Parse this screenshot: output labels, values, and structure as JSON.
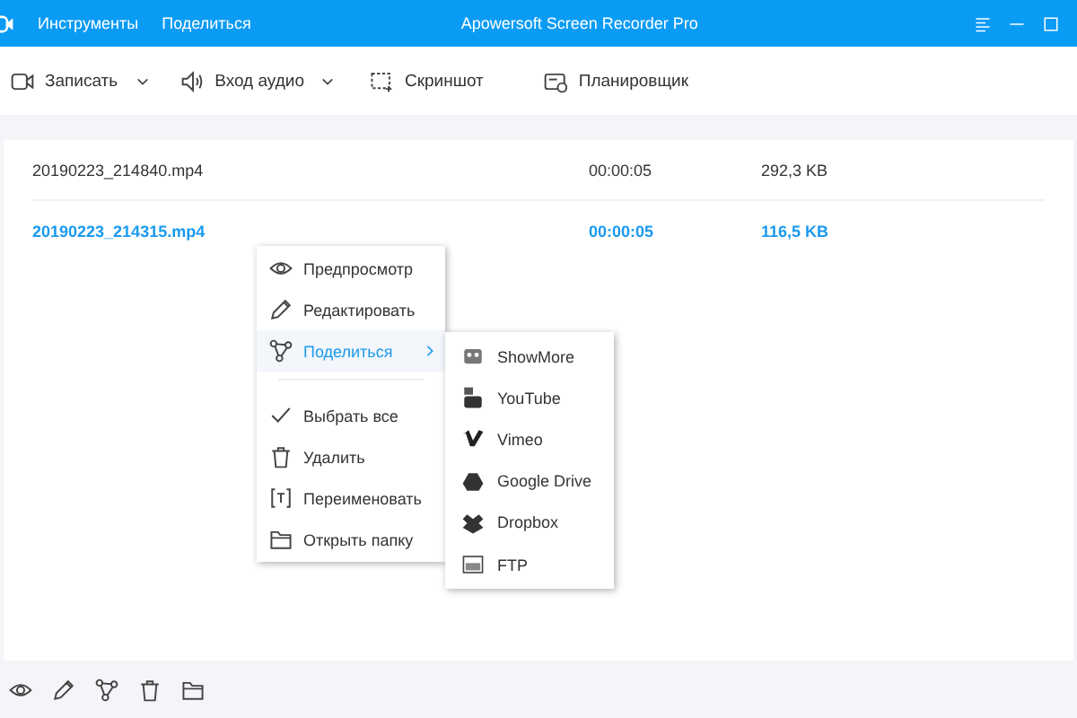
{
  "window": {
    "title": "Apowersoft Screen Recorder Pro",
    "menu": [
      "Инструменты",
      "Поделиться"
    ]
  },
  "toolbar": [
    {
      "label": "Записать",
      "kind": "record",
      "dropdown": true
    },
    {
      "label": "Вход аудио",
      "kind": "audio",
      "dropdown": true
    },
    {
      "label": "Скриншот",
      "kind": "screenshot",
      "dropdown": false
    },
    {
      "label": "Планировщик",
      "kind": "scheduler",
      "dropdown": false
    }
  ],
  "files": [
    {
      "name": "20190223_214840.mp4",
      "duration": "00:00:05",
      "size": "292,3 KB",
      "selected": false
    },
    {
      "name": "20190223_214315.mp4",
      "duration": "00:00:05",
      "size": "116,5 KB",
      "selected": true
    }
  ],
  "context_menu": [
    {
      "label": "Предпросмотр",
      "kind": "eye",
      "selected": false,
      "submenu": false
    },
    {
      "label": "Редактировать",
      "kind": "pencil",
      "selected": false,
      "submenu": false
    },
    {
      "label": "Поделиться",
      "kind": "share",
      "selected": true,
      "submenu": true
    },
    {
      "label": "Выбрать все",
      "kind": "check",
      "selected": false,
      "submenu": false,
      "separator_before": true
    },
    {
      "label": "Удалить",
      "kind": "trash",
      "selected": false,
      "submenu": false
    },
    {
      "label": "Переименовать",
      "kind": "rename",
      "selected": false,
      "submenu": false
    },
    {
      "label": "Открыть папку",
      "kind": "folder",
      "selected": false,
      "submenu": false
    }
  ],
  "share_menu": [
    {
      "label": "ShowMore",
      "kind": "showmore"
    },
    {
      "label": "YouTube",
      "kind": "youtube"
    },
    {
      "label": "Vimeo",
      "kind": "vimeo"
    },
    {
      "label": "Google Drive",
      "kind": "drive"
    },
    {
      "label": "Dropbox",
      "kind": "dropbox"
    },
    {
      "label": "FTP",
      "kind": "ftp"
    }
  ],
  "bottom_bar": [
    {
      "kind": "eye"
    },
    {
      "kind": "pencil"
    },
    {
      "kind": "share"
    },
    {
      "kind": "trash"
    },
    {
      "kind": "folder"
    }
  ]
}
